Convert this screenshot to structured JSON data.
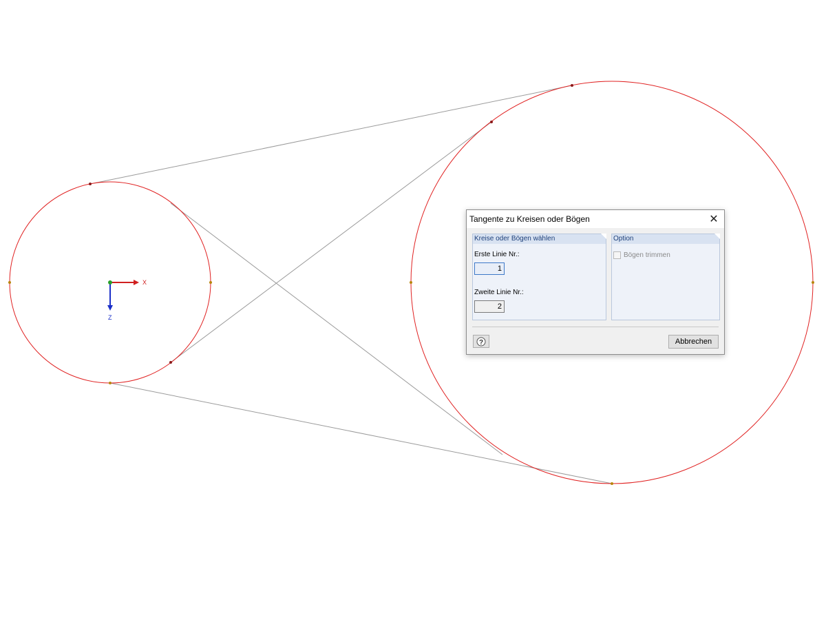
{
  "canvas": {
    "circle_color": "#e02020",
    "tangent_line_color": "#9a9a9a",
    "node_color": "#8b1a1a",
    "axes": {
      "x_label": "X",
      "z_label": "Z",
      "x_color": "#d02020",
      "z_color": "#1a2fc8",
      "origin_color": "#2aa02a"
    }
  },
  "dialog": {
    "title": "Tangente zu Kreisen oder Bögen",
    "close_icon": "close-icon",
    "group_lines": {
      "header": "Kreise oder Bögen wählen",
      "first_label": "Erste Linie Nr.:",
      "first_value": "1",
      "second_label": "Zweite Linie Nr.:",
      "second_value": "2"
    },
    "group_option": {
      "header": "Option",
      "trim_label": "Bögen trimmen",
      "trim_checked": false
    },
    "help_icon": "help-icon",
    "cancel_label": "Abbrechen"
  }
}
